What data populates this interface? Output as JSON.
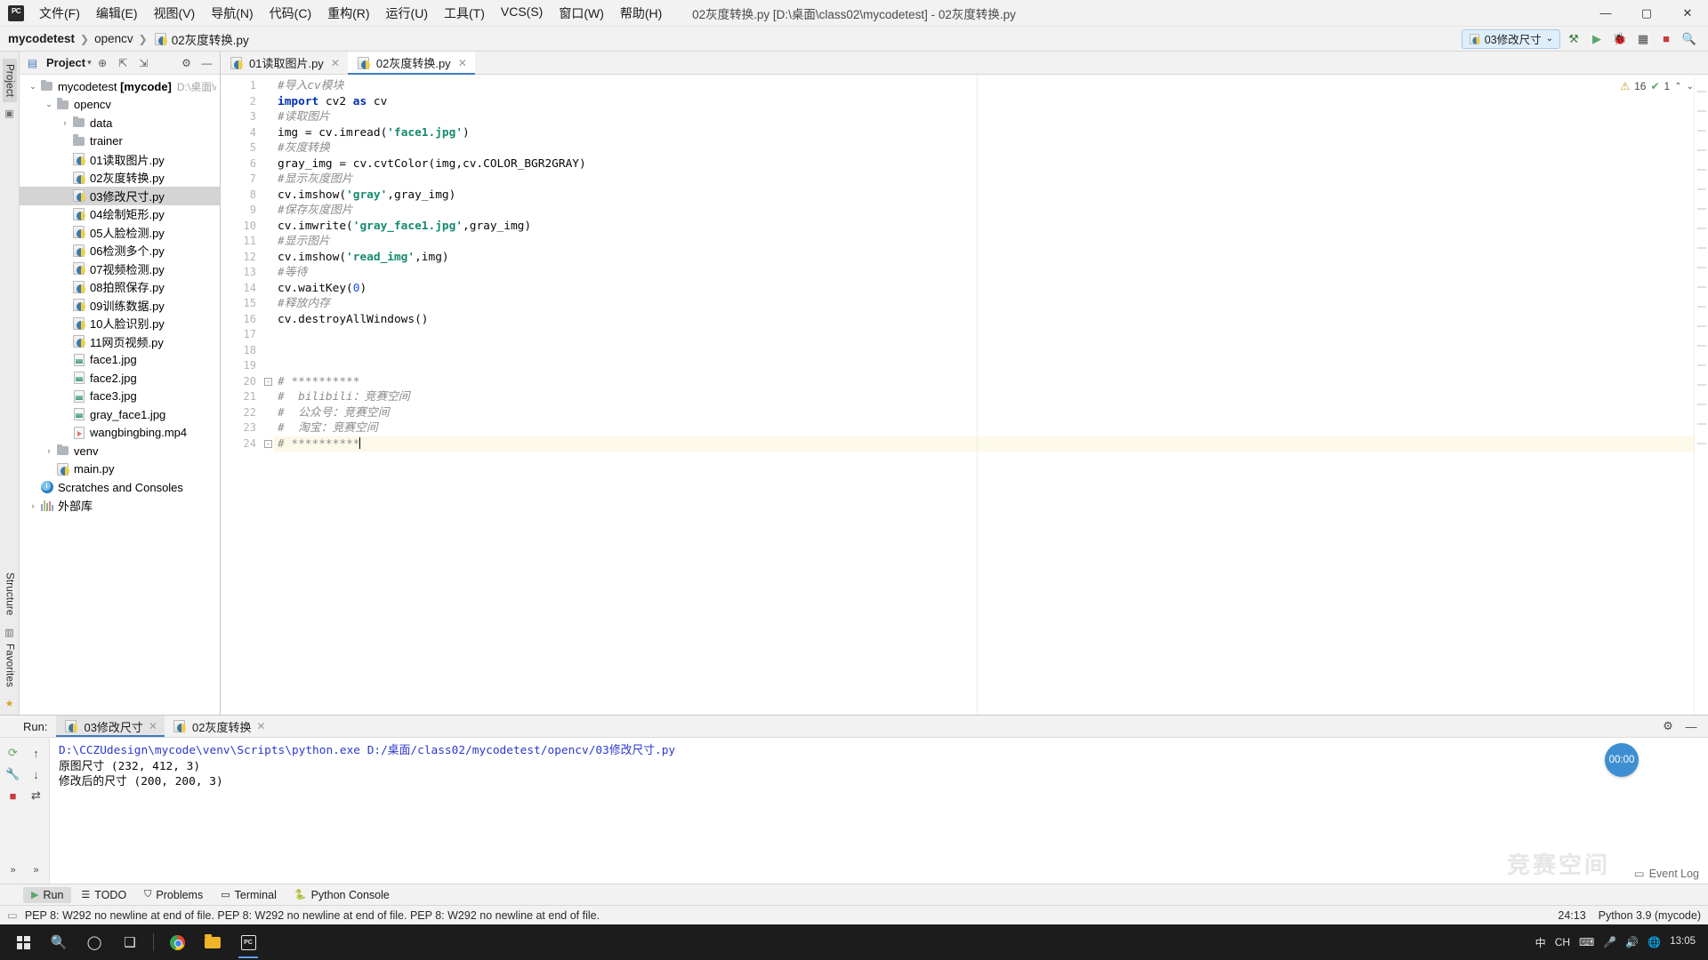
{
  "window": {
    "title": "02灰度转换.py [D:\\桌面\\class02\\mycodetest] - 02灰度转换.py",
    "minimize": "—",
    "maximize": "▢",
    "close": "✕"
  },
  "menu": {
    "logo": "PC",
    "items": [
      "文件(F)",
      "编辑(E)",
      "视图(V)",
      "导航(N)",
      "代码(C)",
      "重构(R)",
      "运行(U)",
      "工具(T)",
      "VCS(S)",
      "窗口(W)",
      "帮助(H)"
    ]
  },
  "breadcrumb": {
    "project": "mycodetest",
    "folder": "opencv",
    "file": "02灰度转换.py",
    "separator": "❯"
  },
  "nav_toolbar": {
    "run_config": "03修改尺寸",
    "run_config_caret": "⌄",
    "icons": [
      {
        "name": "build-icon",
        "glyph": "⚒"
      },
      {
        "name": "run-icon",
        "glyph": "▶"
      },
      {
        "name": "debug-icon",
        "glyph": "🐞"
      },
      {
        "name": "coverage-icon",
        "glyph": "▦"
      },
      {
        "name": "stop-icon",
        "glyph": "■"
      },
      {
        "name": "search-everywhere-icon",
        "glyph": "🔍"
      }
    ]
  },
  "left_strip": {
    "project_tab": "Project",
    "structure_tab": "Structure",
    "favorites_tab": "Favorites"
  },
  "project_panel": {
    "title": "Project",
    "title_caret": "▾",
    "toolbar_icons": [
      {
        "name": "locate-icon",
        "glyph": "⊕"
      },
      {
        "name": "expand-all-icon",
        "glyph": "⇱"
      },
      {
        "name": "collapse-all-icon",
        "glyph": "⇲"
      },
      {
        "name": "settings-gear-icon",
        "glyph": "⚙"
      },
      {
        "name": "hide-panel-icon",
        "glyph": "—"
      }
    ],
    "tree": [
      {
        "label": "mycodetest",
        "bracket": " [mycode]",
        "path": "D:\\桌面\\cla",
        "type": "folder",
        "depth": 0,
        "arrow": "⌄",
        "selected": false
      },
      {
        "label": "opencv",
        "type": "folder",
        "depth": 1,
        "arrow": "⌄",
        "selected": false
      },
      {
        "label": "data",
        "type": "folder",
        "depth": 2,
        "arrow": "›",
        "selected": false
      },
      {
        "label": "trainer",
        "type": "folder",
        "depth": 2,
        "arrow": "",
        "selected": false
      },
      {
        "label": "01读取图片.py",
        "type": "py",
        "depth": 2,
        "arrow": "",
        "selected": false
      },
      {
        "label": "02灰度转换.py",
        "type": "py",
        "depth": 2,
        "arrow": "",
        "selected": false
      },
      {
        "label": "03修改尺寸.py",
        "type": "py",
        "depth": 2,
        "arrow": "",
        "selected": true
      },
      {
        "label": "04绘制矩形.py",
        "type": "py",
        "depth": 2,
        "arrow": "",
        "selected": false
      },
      {
        "label": "05人脸检测.py",
        "type": "py",
        "depth": 2,
        "arrow": "",
        "selected": false
      },
      {
        "label": "06检测多个.py",
        "type": "py",
        "depth": 2,
        "arrow": "",
        "selected": false
      },
      {
        "label": "07视频检测.py",
        "type": "py",
        "depth": 2,
        "arrow": "",
        "selected": false
      },
      {
        "label": "08拍照保存.py",
        "type": "py",
        "depth": 2,
        "arrow": "",
        "selected": false
      },
      {
        "label": "09训练数据.py",
        "type": "py",
        "depth": 2,
        "arrow": "",
        "selected": false
      },
      {
        "label": "10人脸识别.py",
        "type": "py",
        "depth": 2,
        "arrow": "",
        "selected": false
      },
      {
        "label": "11网页视频.py",
        "type": "py",
        "depth": 2,
        "arrow": "",
        "selected": false
      },
      {
        "label": "face1.jpg",
        "type": "img",
        "depth": 2,
        "arrow": "",
        "selected": false
      },
      {
        "label": "face2.jpg",
        "type": "img",
        "depth": 2,
        "arrow": "",
        "selected": false
      },
      {
        "label": "face3.jpg",
        "type": "img",
        "depth": 2,
        "arrow": "",
        "selected": false
      },
      {
        "label": "gray_face1.jpg",
        "type": "img",
        "depth": 2,
        "arrow": "",
        "selected": false
      },
      {
        "label": "wangbingbing.mp4",
        "type": "vid",
        "depth": 2,
        "arrow": "",
        "selected": false
      },
      {
        "label": "venv",
        "type": "folder",
        "depth": 1,
        "arrow": "›",
        "selected": false
      },
      {
        "label": "main.py",
        "type": "py",
        "depth": 1,
        "arrow": "",
        "selected": false
      },
      {
        "label": "Scratches and Consoles",
        "type": "scratch",
        "depth": 0,
        "arrow": "",
        "selected": false
      },
      {
        "label": "外部库",
        "type": "lib",
        "depth": 0,
        "arrow": "›",
        "selected": false
      }
    ]
  },
  "editor": {
    "tabs": [
      {
        "label": "01读取图片.py",
        "active": false,
        "close": "✕"
      },
      {
        "label": "02灰度转换.py",
        "active": true,
        "close": "✕"
      }
    ],
    "inspection": {
      "warning_count": "16",
      "warning_glyph": "⚠",
      "ok_count": "1",
      "ok_glyph": "✔",
      "up_arrow": "⌃",
      "down_arrow": "⌄"
    },
    "lines": [
      {
        "n": 1,
        "tokens": [
          {
            "t": "#导入cv模块",
            "c": "cmt"
          }
        ]
      },
      {
        "n": 2,
        "tokens": [
          {
            "t": "import",
            "c": "kw"
          },
          {
            "t": " cv2 ",
            "c": "plain"
          },
          {
            "t": "as",
            "c": "kw"
          },
          {
            "t": " cv",
            "c": "plain"
          }
        ]
      },
      {
        "n": 3,
        "tokens": [
          {
            "t": "#读取图片",
            "c": "cmt"
          }
        ]
      },
      {
        "n": 4,
        "tokens": [
          {
            "t": "img = cv.imread(",
            "c": "plain"
          },
          {
            "t": "'face1.jpg'",
            "c": "str"
          },
          {
            "t": ")",
            "c": "plain"
          }
        ]
      },
      {
        "n": 5,
        "tokens": [
          {
            "t": "#灰度转换",
            "c": "cmt"
          }
        ]
      },
      {
        "n": 6,
        "tokens": [
          {
            "t": "gray_img = cv.cvtColor(img,cv.COLOR_BGR2GRAY)",
            "c": "plain"
          }
        ]
      },
      {
        "n": 7,
        "tokens": [
          {
            "t": "#显示灰度图片",
            "c": "cmt"
          }
        ]
      },
      {
        "n": 8,
        "tokens": [
          {
            "t": "cv.imshow(",
            "c": "plain"
          },
          {
            "t": "'gray'",
            "c": "str"
          },
          {
            "t": ",gray_img)",
            "c": "plain"
          }
        ]
      },
      {
        "n": 9,
        "tokens": [
          {
            "t": "#保存灰度图片",
            "c": "cmt"
          }
        ]
      },
      {
        "n": 10,
        "tokens": [
          {
            "t": "cv.imwrite(",
            "c": "plain"
          },
          {
            "t": "'gray_face1.jpg'",
            "c": "str"
          },
          {
            "t": ",gray_img)",
            "c": "plain"
          }
        ]
      },
      {
        "n": 11,
        "tokens": [
          {
            "t": "#显示图片",
            "c": "cmt"
          }
        ]
      },
      {
        "n": 12,
        "tokens": [
          {
            "t": "cv.imshow(",
            "c": "plain"
          },
          {
            "t": "'read_img'",
            "c": "str"
          },
          {
            "t": ",img)",
            "c": "plain"
          }
        ]
      },
      {
        "n": 13,
        "tokens": [
          {
            "t": "#等待",
            "c": "cmt"
          }
        ]
      },
      {
        "n": 14,
        "tokens": [
          {
            "t": "cv.waitKey(",
            "c": "plain"
          },
          {
            "t": "0",
            "c": "num"
          },
          {
            "t": ")",
            "c": "plain"
          }
        ]
      },
      {
        "n": 15,
        "tokens": [
          {
            "t": "#释放内存",
            "c": "cmt"
          }
        ]
      },
      {
        "n": 16,
        "tokens": [
          {
            "t": "cv.destroyAllWindows()",
            "c": "plain"
          }
        ]
      },
      {
        "n": 17,
        "tokens": []
      },
      {
        "n": 18,
        "tokens": []
      },
      {
        "n": 19,
        "tokens": []
      },
      {
        "n": 20,
        "tokens": [
          {
            "t": "# **********",
            "c": "cmt"
          }
        ],
        "fold": "-"
      },
      {
        "n": 21,
        "tokens": [
          {
            "t": "#  bilibili：竞赛空间",
            "c": "cmt"
          }
        ]
      },
      {
        "n": 22,
        "tokens": [
          {
            "t": "#  公众号：竞赛空间",
            "c": "cmt"
          }
        ]
      },
      {
        "n": 23,
        "tokens": [
          {
            "t": "#  淘宝：竞赛空间",
            "c": "cmt"
          }
        ]
      },
      {
        "n": 24,
        "tokens": [
          {
            "t": "# **********",
            "c": "cmt"
          }
        ],
        "fold": "-",
        "current": true,
        "caret": true
      }
    ]
  },
  "run_panel": {
    "label": "Run:",
    "tabs": [
      {
        "label": "03修改尺寸",
        "active": true,
        "close": "✕"
      },
      {
        "label": "02灰度转换",
        "active": false,
        "close": "✕"
      }
    ],
    "gutter_icons": [
      {
        "name": "rerun-icon",
        "glyph": "⟳"
      },
      {
        "name": "scroll-up-icon",
        "glyph": "↑"
      },
      {
        "name": "wrench-icon",
        "glyph": "🔧"
      },
      {
        "name": "scroll-down-icon",
        "glyph": "↓"
      },
      {
        "name": "stop-icon",
        "glyph": "■"
      },
      {
        "name": "soft-wrap-icon",
        "glyph": "⇄"
      },
      {
        "name": "expand-left-icon",
        "glyph": "»"
      },
      {
        "name": "expand-right-icon",
        "glyph": "»"
      }
    ],
    "console_lines": [
      {
        "text": "D:\\CCZUdesign\\mycode\\venv\\Scripts\\python.exe D:/桌面/class02/mycodetest/opencv/03修改尺寸.py",
        "kind": "cmdline"
      },
      {
        "text": "原图尺寸 (232, 412, 3)",
        "kind": "out"
      },
      {
        "text": "修改后的尺寸 (200, 200, 3)",
        "kind": "out"
      }
    ],
    "timer": "00:00",
    "settings_icon": "⚙",
    "hide_icon": "—",
    "watermark": "竞赛空间",
    "event_log": "Event Log",
    "event_log_icon": "▭"
  },
  "tool_buttons": [
    {
      "label": "Run",
      "icon": "▶",
      "active": true,
      "name": "tool-button-run"
    },
    {
      "label": "TODO",
      "icon": "☰",
      "active": false,
      "name": "tool-button-todo"
    },
    {
      "label": "Problems",
      "icon": "⛉",
      "active": false,
      "name": "tool-button-problems"
    },
    {
      "label": "Terminal",
      "icon": "▭",
      "active": false,
      "name": "tool-button-terminal"
    },
    {
      "label": "Python Console",
      "icon": "🐍",
      "active": false,
      "name": "tool-button-python-console"
    }
  ],
  "status_bar": {
    "icon": "▭",
    "message": "PEP 8: W292 no newline at end of file. PEP 8: W292 no newline at end of file. PEP 8: W292 no newline at end of file.",
    "caret_position": "24:13",
    "interpreter": "Python 3.9 (mycode)"
  },
  "taskbar": {
    "start": "start-icon",
    "search": "🔍",
    "cortana": "◯",
    "taskview": "❑",
    "apps": [
      {
        "name": "chrome-taskbar-icon",
        "open": false
      },
      {
        "name": "file-explorer-taskbar-icon",
        "open": false
      },
      {
        "name": "pycharm-taskbar-icon",
        "open": true
      }
    ],
    "tray": {
      "ime": "中",
      "lang": "CH",
      "icons": [
        "⌨",
        "🎤",
        "🔊",
        "🌐"
      ],
      "time": "13:05",
      "date": ""
    }
  }
}
